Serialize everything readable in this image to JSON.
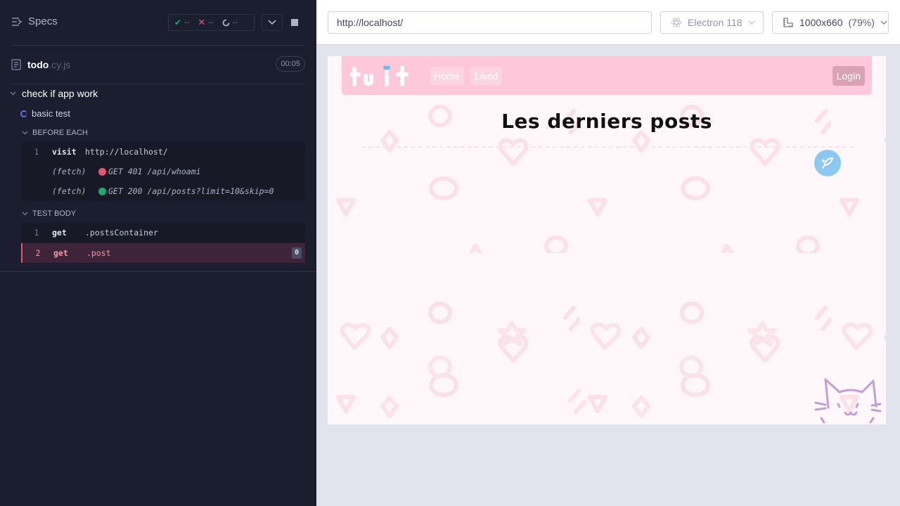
{
  "reporter": {
    "specs_label": "Specs",
    "stats": {
      "passed": "--",
      "failed": "--",
      "pending": "--"
    },
    "spec": {
      "name": "todo",
      "ext": ".cy.js",
      "duration": "00:05"
    },
    "suite": {
      "title": "check if app work"
    },
    "test": {
      "title": "basic test"
    },
    "before_each": {
      "label": "BEFORE EACH",
      "commands": [
        {
          "num": "1",
          "name": "visit",
          "message": "http://localhost/"
        }
      ],
      "fetches": [
        {
          "label": "(fetch)",
          "status_color": "#e45770",
          "request": "GET 401 /api/whoami"
        },
        {
          "label": "(fetch)",
          "status_color": "#1fa971",
          "request": "GET 200 /api/posts?limit=10&skip=0"
        }
      ]
    },
    "test_body": {
      "label": "TEST BODY",
      "commands": [
        {
          "num": "1",
          "name": "get",
          "message": ".postsContainer"
        },
        {
          "num": "2",
          "name": "get",
          "message": ".post",
          "count": "0",
          "state": "failed"
        }
      ]
    }
  },
  "aut_header": {
    "url": "http://localhost/",
    "browser": "Electron 118",
    "viewport": "1000x660",
    "scale": "(79%)"
  },
  "app": {
    "logo_text": "tuit",
    "nav": {
      "home": "Home",
      "liked": "Liked",
      "login": "Login"
    },
    "title": "Les derniers posts"
  },
  "colors": {
    "reporter_bg": "#1b1e2e",
    "navbar_bg": "#ffc8da",
    "fab_bg": "#8cc8f2",
    "failed_accent": "#e45770",
    "passed_accent": "#1fa971"
  }
}
